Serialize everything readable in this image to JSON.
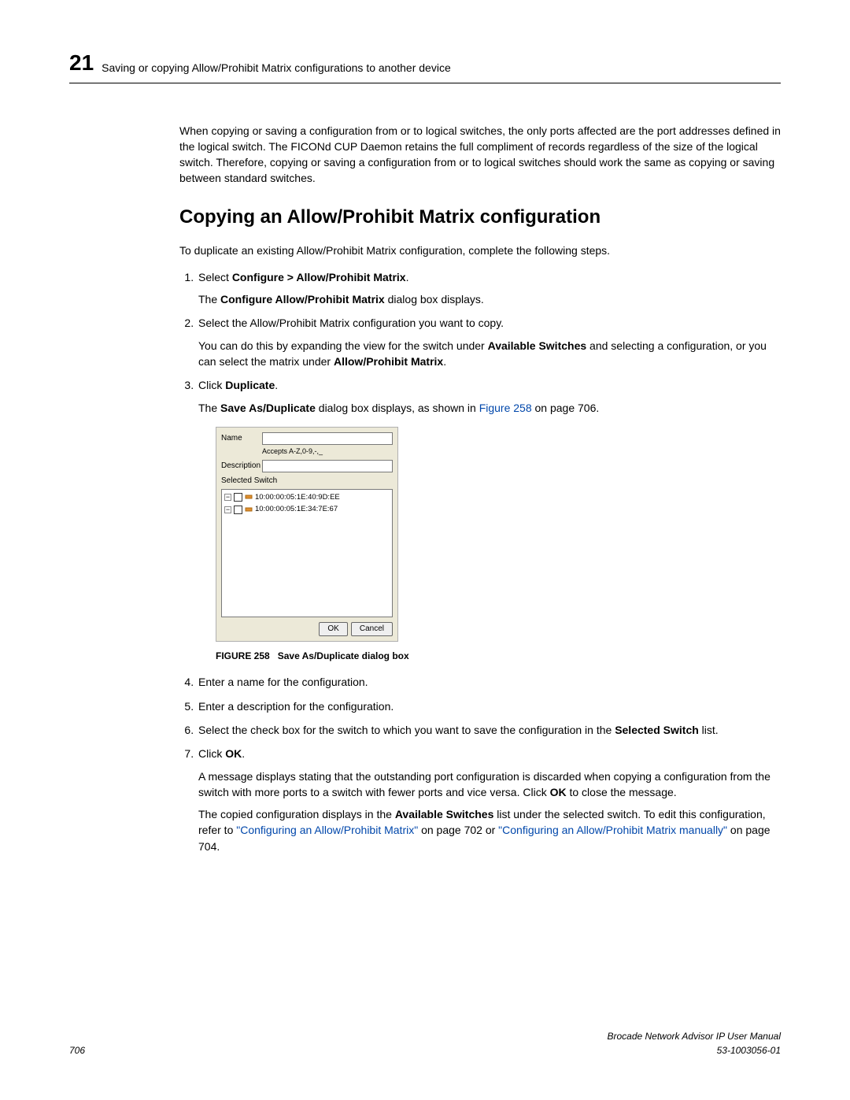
{
  "header": {
    "chapter_number": "21",
    "running_title": "Saving or copying Allow/Prohibit Matrix configurations to another device"
  },
  "intro_paragraph": "When copying or saving a configuration from or to logical switches, the only ports affected are the port addresses defined in the logical switch. The FICONd CUP Daemon retains the full compliment of records regardless of the size of the logical switch. Therefore, copying or saving a configuration from or to logical switches should work the same as copying or saving between standard switches.",
  "section_title": "Copying an Allow/Prohibit Matrix configuration",
  "section_intro": "To duplicate an existing Allow/Prohibit Matrix configuration, complete the following steps.",
  "steps": {
    "s1_pre": "Select ",
    "s1_bold": "Configure > Allow/Prohibit Matrix",
    "s1_post": ".",
    "s1_sub_pre": "The ",
    "s1_sub_bold": "Configure Allow/Prohibit Matrix",
    "s1_sub_post": " dialog box displays.",
    "s2_main": "Select the Allow/Prohibit Matrix configuration you want to copy.",
    "s2_sub_pre": "You can do this by expanding the view for the switch under ",
    "s2_sub_bold1": "Available Switches",
    "s2_sub_mid": " and selecting a configuration, or you can select the matrix under ",
    "s2_sub_bold2": "Allow/Prohibit Matrix",
    "s2_sub_post": ".",
    "s3_pre": "Click ",
    "s3_bold": "Duplicate",
    "s3_post": ".",
    "s3_sub_pre": "The ",
    "s3_sub_bold": "Save As/Duplicate",
    "s3_sub_mid": " dialog box displays, as shown in ",
    "s3_sub_link": "Figure 258",
    "s3_sub_post": " on page 706.",
    "s4": "Enter a name for the configuration.",
    "s5": "Enter a description for the configuration.",
    "s6_pre": "Select the check box for the switch to which you want to save the configuration in the ",
    "s6_bold": "Selected Switch",
    "s6_post": " list.",
    "s7_pre": "Click ",
    "s7_bold": "OK",
    "s7_post": ".",
    "s7_sub1_pre": "A message displays stating that the outstanding port configuration is discarded when copying a configuration from the switch with more ports to a switch with fewer ports and vice versa. Click ",
    "s7_sub1_bold": "OK",
    "s7_sub1_post": " to close the message.",
    "s7_sub2_pre": "The copied configuration displays in the ",
    "s7_sub2_bold": "Available Switches",
    "s7_sub2_mid": " list under the selected switch. To edit this configuration, refer to ",
    "s7_sub2_link1": "\"Configuring an Allow/Prohibit Matrix\"",
    "s7_sub2_mid2": " on page 702 or ",
    "s7_sub2_link2": "\"Configuring an Allow/Prohibit Matrix manually\"",
    "s7_sub2_post": " on page 704."
  },
  "dialog": {
    "name_label": "Name",
    "name_hint": "Accepts A-Z,0-9,-,_",
    "desc_label": "Description",
    "sel_switch_label": "Selected Switch",
    "tree_items": [
      "10:00:00:05:1E:40:9D:EE",
      "10:00:00:05:1E:34:7E:67"
    ],
    "ok_label": "OK",
    "cancel_label": "Cancel"
  },
  "figure_caption": {
    "prefix": "FIGURE 258",
    "text": "Save As/Duplicate dialog box"
  },
  "footer": {
    "page_number": "706",
    "manual_title": "Brocade Network Advisor IP User Manual",
    "doc_id": "53-1003056-01"
  }
}
